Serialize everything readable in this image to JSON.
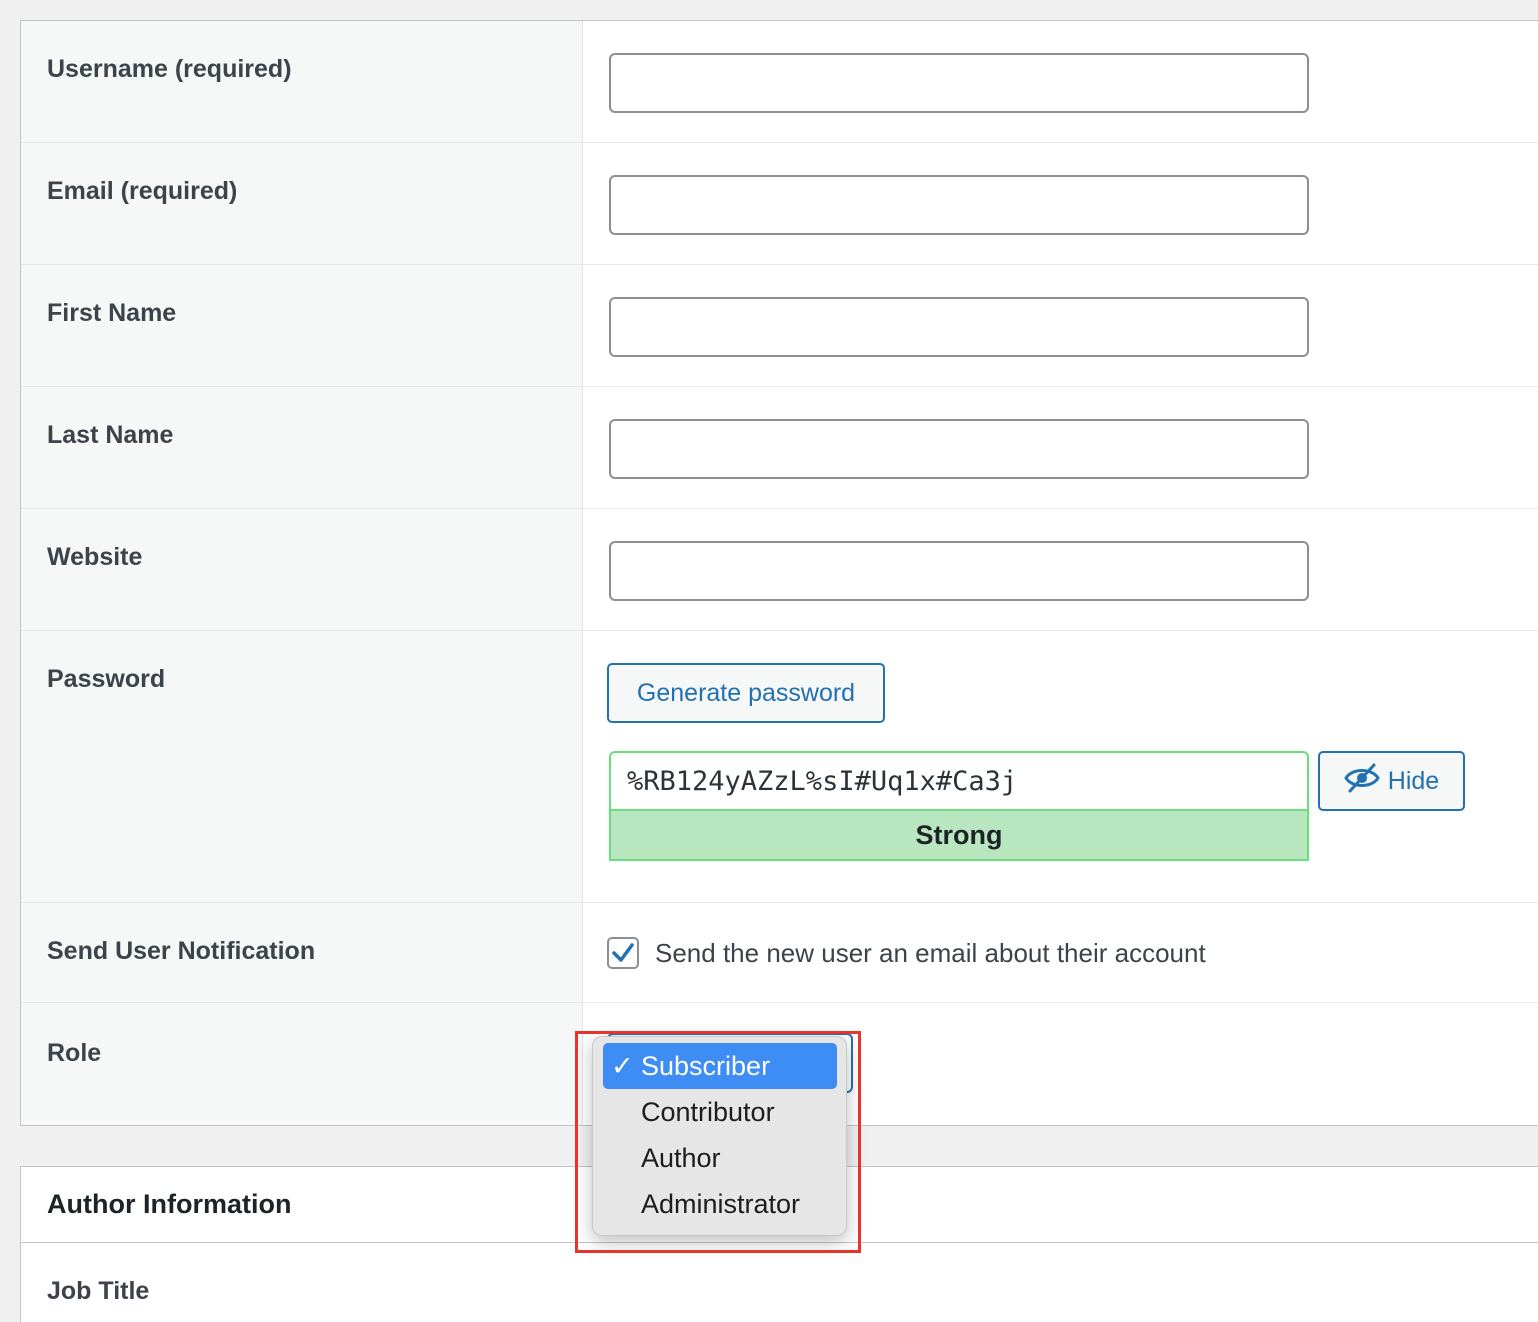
{
  "form": {
    "username_label": "Username (required)",
    "email_label": "Email (required)",
    "first_name_label": "First Name",
    "last_name_label": "Last Name",
    "website_label": "Website",
    "password_label": "Password",
    "generate_password_label": "Generate password",
    "password_value": "%RB124yAZzL%sI#Uq1x#Ca3j",
    "hide_label": "Hide",
    "strength_label": "Strong",
    "notification_label": "Send User Notification",
    "notification_checkbox_label": "Send the new user an email about their account",
    "notification_checked": true,
    "role_label": "Role"
  },
  "role_dropdown": {
    "selected": "Subscriber",
    "options": [
      "Subscriber",
      "Contributor",
      "Author",
      "Administrator"
    ],
    "check_glyph": "✓"
  },
  "author_section": {
    "title": "Author Information",
    "job_title_label": "Job Title"
  },
  "colors": {
    "accent": "#2271b1",
    "strong_bg": "#b8e6bf",
    "strong_border": "#68de7c",
    "highlight": "#e8352b",
    "dropdown_selected": "#3d8df5"
  }
}
